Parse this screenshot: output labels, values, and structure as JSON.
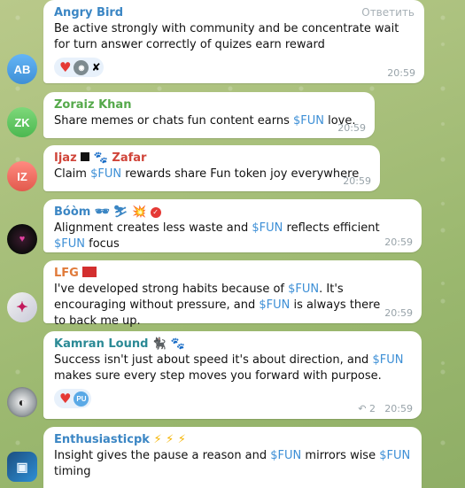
{
  "colors": {
    "accent_link": "#3d8fd6",
    "name_green": "#55a94b",
    "name_blue": "#3b86c4",
    "name_red": "#d0453a",
    "name_orange": "#e07a3a",
    "name_teal": "#2b8a95"
  },
  "messages": [
    {
      "sender": "Angry Bird",
      "reply_action": "Ответить",
      "text": "Be active strongly with community and be concentrate wait for turn answer correctly of quizes earn reward",
      "time": "20:59",
      "avatar_initials": "AB"
    },
    {
      "sender": "Zoraiz Khan",
      "text_before": "Share memes or chats  fun content earns ",
      "token": "$FUN",
      "text_after": " love.",
      "time": "20:59",
      "avatar_initials": "ZK"
    },
    {
      "sender_part1": "Ijaz",
      "sender_part2": "Zafar",
      "sender_emoji": "🐾",
      "text_before": "Claim ",
      "token": "$FUN",
      "text_after": " rewards share Fun token joy everywhere",
      "time": "20:59",
      "avatar_initials": "IZ"
    },
    {
      "sender": "Bóòm 🕶",
      "sender_emoji": "💥",
      "text_before": "Alignment creates less waste and ",
      "token": "$FUN",
      "text_middle": " reflects efficient ",
      "token2": "$FUN",
      "text_after": " focus",
      "time": "20:59"
    },
    {
      "sender": "LFG",
      "text_before": "I've developed strong habits because of ",
      "token": "$FUN",
      "text_middle": ". It's encouraging without pressure, and ",
      "token2": "$FUN",
      "text_after": " is always there to back me up.",
      "time": "20:59"
    },
    {
      "sender": "Kamran Lound",
      "sender_emoji": "🐈‍⬛ 🐾",
      "text_before": "Success isn't just about speed  it's about direction, and ",
      "token": "$FUN",
      "text_after": " makes sure every step moves you forward with purpose.",
      "reaction_avatar": "PU",
      "reply_count": "2",
      "time": "20:59"
    },
    {
      "sender": "Enthusiasticpk",
      "sender_emoji": "⚡ ⚡ ⚡",
      "text_before": "Insight gives the pause a reason and ",
      "token": "$FUN",
      "text_middle": " mirrors wise ",
      "token2": "$FUN",
      "text_after": " timing"
    }
  ]
}
